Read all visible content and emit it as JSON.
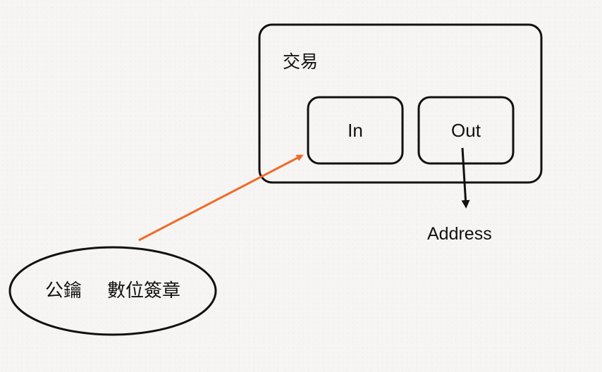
{
  "diagram": {
    "transaction_label": "交易",
    "in_label": "In",
    "out_label": "Out",
    "address_label": "Address",
    "public_key_label": "公鑰",
    "signature_label": "數位簽章"
  },
  "colors": {
    "background": "#f6f5f3",
    "stroke": "#111111",
    "accent_arrow": "#f06a28"
  }
}
